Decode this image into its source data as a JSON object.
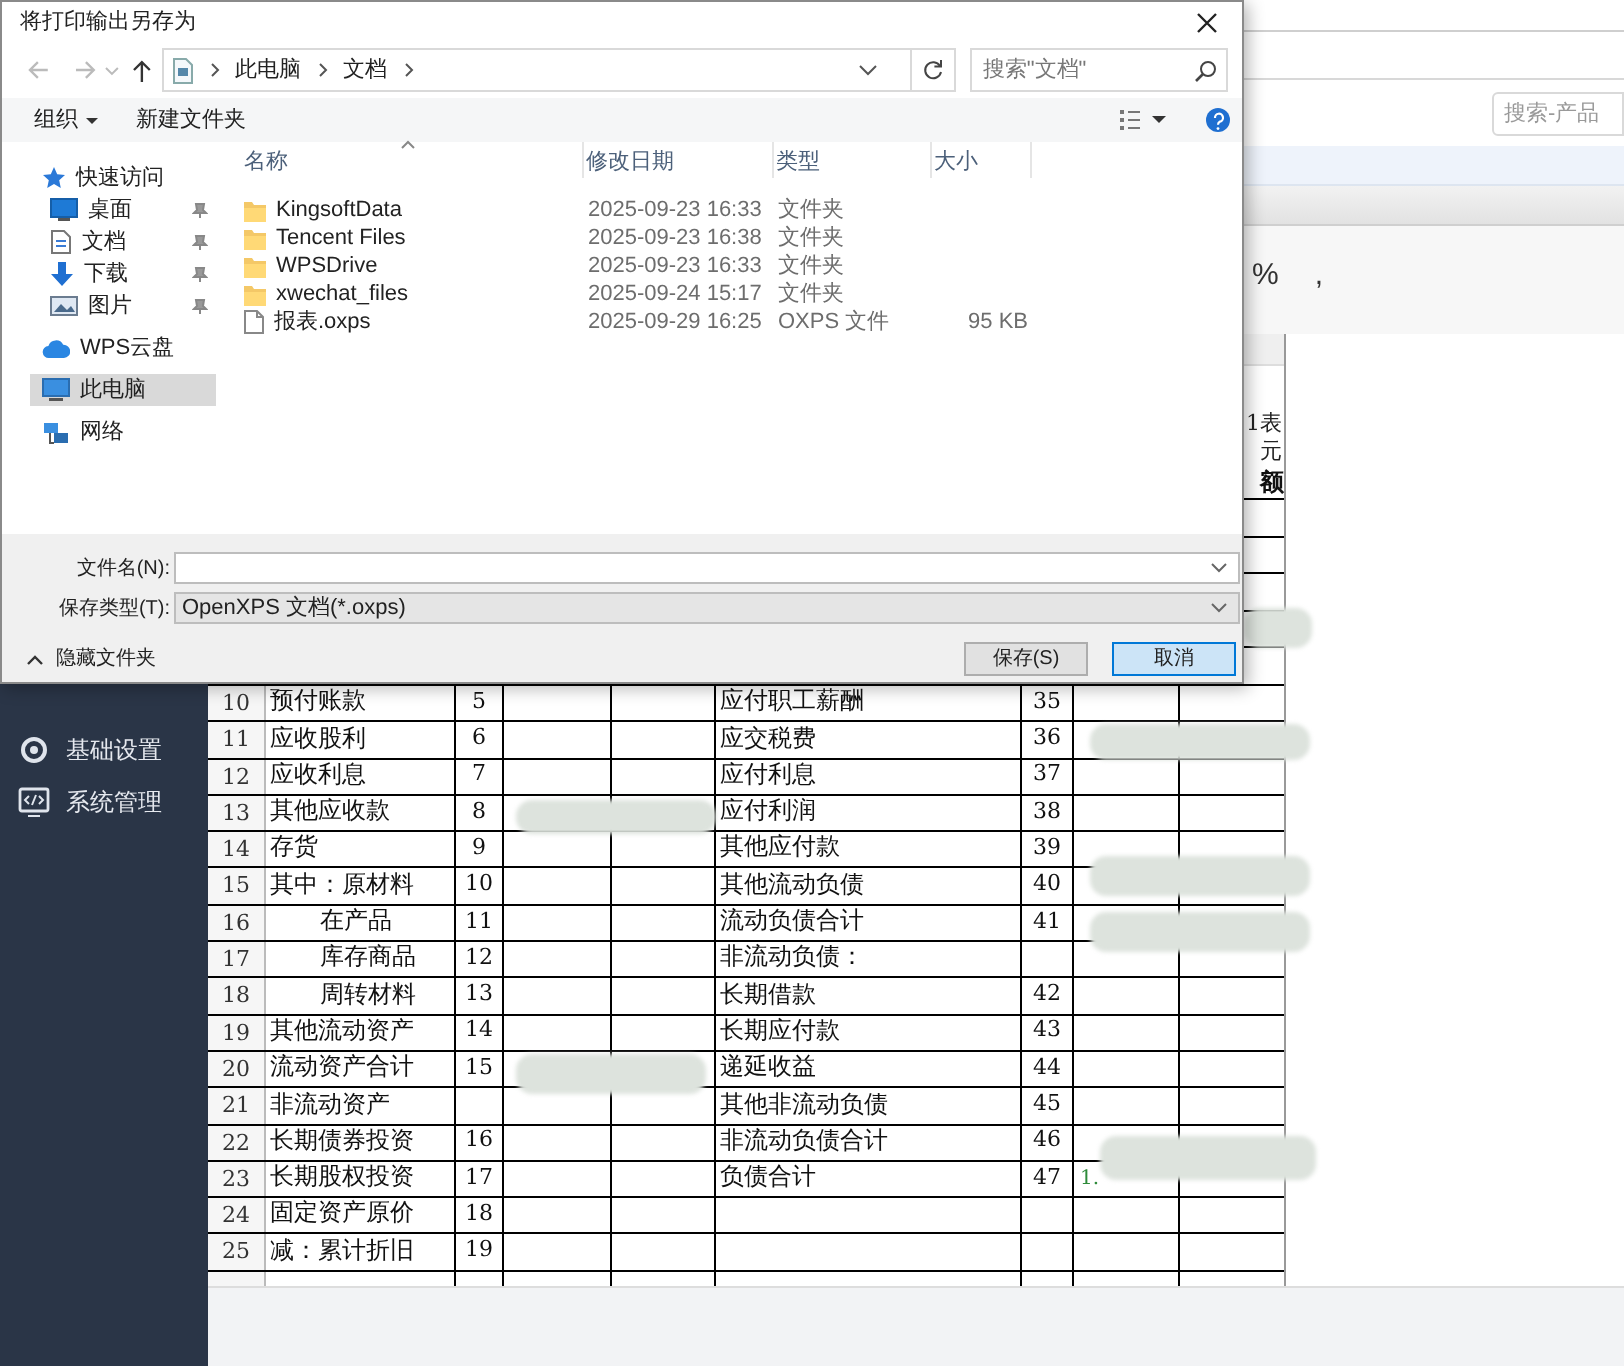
{
  "app": {
    "search_placeholder": "搜索-产品",
    "menu": [
      {
        "kind": "gear",
        "label": "基础设置"
      },
      {
        "kind": "code",
        "label": "系统管理"
      }
    ],
    "format_symbols": [
      "%",
      ","
    ],
    "sheet": {
      "code": "1表",
      "unit": "元",
      "last_header": "额",
      "rows": [
        {
          "n": "10",
          "a": "预付账款",
          "b": "5",
          "e": "应付职工薪酬",
          "f": "35"
        },
        {
          "n": "11",
          "a": "应收股利",
          "b": "6",
          "e": "应交税费",
          "f": "36"
        },
        {
          "n": "12",
          "a": "应收利息",
          "b": "7",
          "e": "应付利息",
          "f": "37"
        },
        {
          "n": "13",
          "a": "其他应收款",
          "b": "8",
          "e": "应付利润",
          "f": "38"
        },
        {
          "n": "14",
          "a": "存货",
          "b": "9",
          "e": "其他应付款",
          "f": "39"
        },
        {
          "n": "15",
          "a": "其中：原材料",
          "b": "10",
          "e": "其他流动负债",
          "f": "40"
        },
        {
          "n": "16",
          "a": "在产品",
          "sub": true,
          "b": "11",
          "e": "流动负债合计",
          "f": "41"
        },
        {
          "n": "17",
          "a": "库存商品",
          "sub": true,
          "b": "12",
          "e": "非流动负债："
        },
        {
          "n": "18",
          "a": "周转材料",
          "sub": true,
          "b": "13",
          "e": "长期借款",
          "f": "42"
        },
        {
          "n": "19",
          "a": "其他流动资产",
          "b": "14",
          "e": "长期应付款",
          "f": "43"
        },
        {
          "n": "20",
          "a": "流动资产合计",
          "b": "15",
          "e": "递延收益",
          "f": "44"
        },
        {
          "n": "21",
          "a": "非流动资产",
          "e": "其他非流动负债",
          "f": "45"
        },
        {
          "n": "22",
          "a": "长期债券投资",
          "b": "16",
          "e": "非流动负债合计",
          "f": "46"
        },
        {
          "n": "23",
          "a": "长期股权投资",
          "b": "17",
          "e": "负债合计",
          "f": "47",
          "g": "1."
        },
        {
          "n": "24",
          "a": "固定资产原价",
          "b": "18"
        },
        {
          "n": "25",
          "a": "减：累计折旧",
          "b": "19"
        }
      ]
    }
  },
  "dialog": {
    "title": "将打印输出另存为",
    "path": [
      "此电脑",
      "文档"
    ],
    "search_placeholder": "搜索\"文档\"",
    "toolbar": [
      "组织",
      "新建文件夹"
    ],
    "nav": [
      {
        "kind": "star",
        "label": "快速访问",
        "selected": false,
        "children": [
          {
            "kind": "desktop",
            "label": "桌面",
            "pinned": true,
            "selected": false
          },
          {
            "kind": "document",
            "label": "文档",
            "pinned": true,
            "selected": false
          },
          {
            "kind": "download",
            "label": "下载",
            "pinned": true,
            "selected": false
          },
          {
            "kind": "picture",
            "label": "图片",
            "pinned": true,
            "selected": false
          }
        ]
      },
      {
        "kind": "cloud",
        "label": "WPS云盘",
        "selected": false
      },
      {
        "kind": "pc",
        "label": "此电脑",
        "selected": true
      },
      {
        "kind": "network",
        "label": "网络",
        "selected": false
      }
    ],
    "columns": [
      "名称",
      "修改日期",
      "类型",
      "大小"
    ],
    "files": [
      {
        "kind": "folder",
        "name": "KingsoftData",
        "modified": "2025-09-23 16:33",
        "type": "文件夹"
      },
      {
        "kind": "folder",
        "name": "Tencent Files",
        "modified": "2025-09-23 16:38",
        "type": "文件夹"
      },
      {
        "kind": "folder",
        "name": "WPSDrive",
        "modified": "2025-09-23 16:33",
        "type": "文件夹"
      },
      {
        "kind": "folder",
        "name": "xwechat_files",
        "modified": "2025-09-24 15:17",
        "type": "文件夹"
      },
      {
        "kind": "file",
        "name": "报表.oxps",
        "modified": "2025-09-29 16:25",
        "type": "OXPS 文件",
        "size": "95 KB"
      }
    ],
    "filename_label": "文件名(N):",
    "filetype_label": "保存类型(T):",
    "filetype": "OpenXPS 文档(*.oxps)",
    "hide_folders": "隐藏文件夹",
    "buttons": [
      {
        "label": "保存(S)",
        "default": false
      },
      {
        "label": "取消",
        "default": true
      }
    ]
  }
}
